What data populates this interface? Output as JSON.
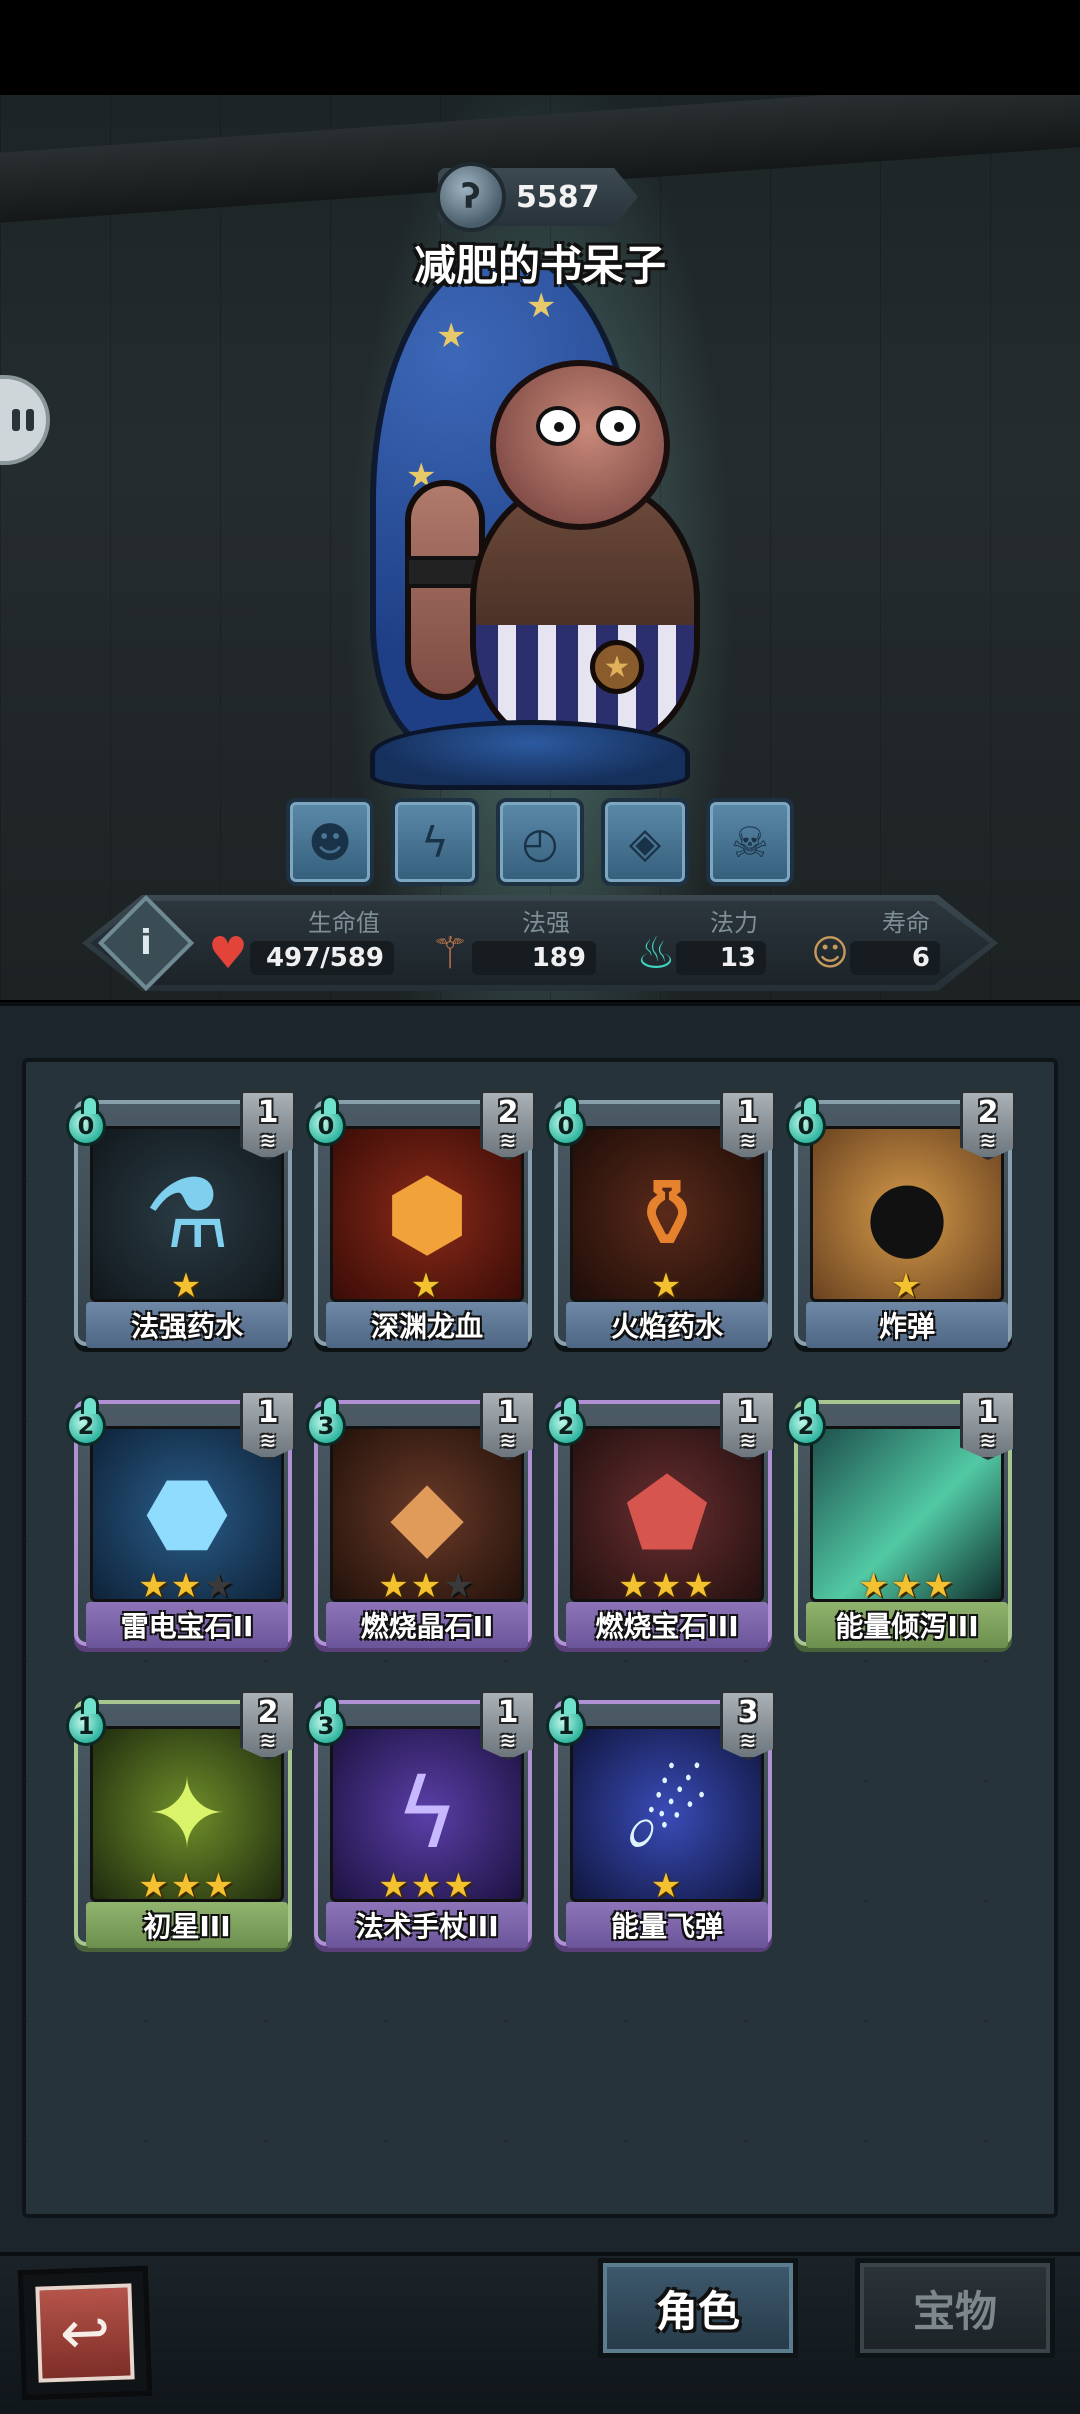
{
  "header": {
    "score": "5587",
    "character_name": "减肥的书呆子"
  },
  "skills": [
    {
      "icon": "beast-face-icon"
    },
    {
      "icon": "crack-rune-icon"
    },
    {
      "icon": "clock-rune-icon"
    },
    {
      "icon": "shatter-rune-icon"
    },
    {
      "icon": "skull-icon"
    }
  ],
  "stats": {
    "hp": {
      "label": "生命值",
      "value": "497/589",
      "icon": "heart-icon"
    },
    "spell_power": {
      "label": "法强",
      "value": "189",
      "icon": "staff-icon"
    },
    "mana": {
      "label": "法力",
      "value": "13",
      "icon": "flame-icon"
    },
    "lifespan": {
      "label": "寿命",
      "value": "6",
      "icon": "portrait-icon"
    }
  },
  "cards": [
    {
      "name": "法强药水",
      "cost": "0",
      "level": "1",
      "stars": 1,
      "max_stars": 1,
      "rarity": "common",
      "art": "potion"
    },
    {
      "name": "深渊龙血",
      "cost": "0",
      "level": "2",
      "stars": 1,
      "max_stars": 1,
      "rarity": "common",
      "art": "dragon-blood"
    },
    {
      "name": "火焰药水",
      "cost": "0",
      "level": "1",
      "stars": 1,
      "max_stars": 1,
      "rarity": "common",
      "art": "fire-potion"
    },
    {
      "name": "炸弹",
      "cost": "0",
      "level": "2",
      "stars": 1,
      "max_stars": 1,
      "rarity": "common",
      "art": "bomb"
    },
    {
      "name": "雷电宝石II",
      "cost": "2",
      "level": "1",
      "stars": 2,
      "max_stars": 3,
      "rarity": "purple",
      "art": "thunder-gem"
    },
    {
      "name": "燃烧晶石II",
      "cost": "3",
      "level": "1",
      "stars": 2,
      "max_stars": 3,
      "rarity": "purple",
      "art": "burning-crystal"
    },
    {
      "name": "燃烧宝石III",
      "cost": "2",
      "level": "1",
      "stars": 3,
      "max_stars": 3,
      "rarity": "purple",
      "art": "burning-gem"
    },
    {
      "name": "能量倾泻III",
      "cost": "2",
      "level": "1",
      "stars": 3,
      "max_stars": 3,
      "rarity": "green",
      "art": "energy-pour"
    },
    {
      "name": "初星III",
      "cost": "1",
      "level": "2",
      "stars": 3,
      "max_stars": 3,
      "rarity": "green",
      "art": "first-star"
    },
    {
      "name": "法术手杖III",
      "cost": "3",
      "level": "1",
      "stars": 3,
      "max_stars": 3,
      "rarity": "purple",
      "art": "spell-staff"
    },
    {
      "name": "能量飞弹",
      "cost": "1",
      "level": "3",
      "stars": 1,
      "max_stars": 1,
      "rarity": "purple",
      "art": "energy-missile"
    }
  ],
  "bottom": {
    "back_icon": "return-arrow-icon",
    "tab_character": "角色",
    "tab_treasure": "宝物"
  },
  "colors": {
    "star_on": "#f4c130",
    "mana_drop": "#2fb6a0",
    "common_border": "#8ba0ad",
    "purple_border": "#b092d4",
    "green_border": "#a8c690"
  }
}
